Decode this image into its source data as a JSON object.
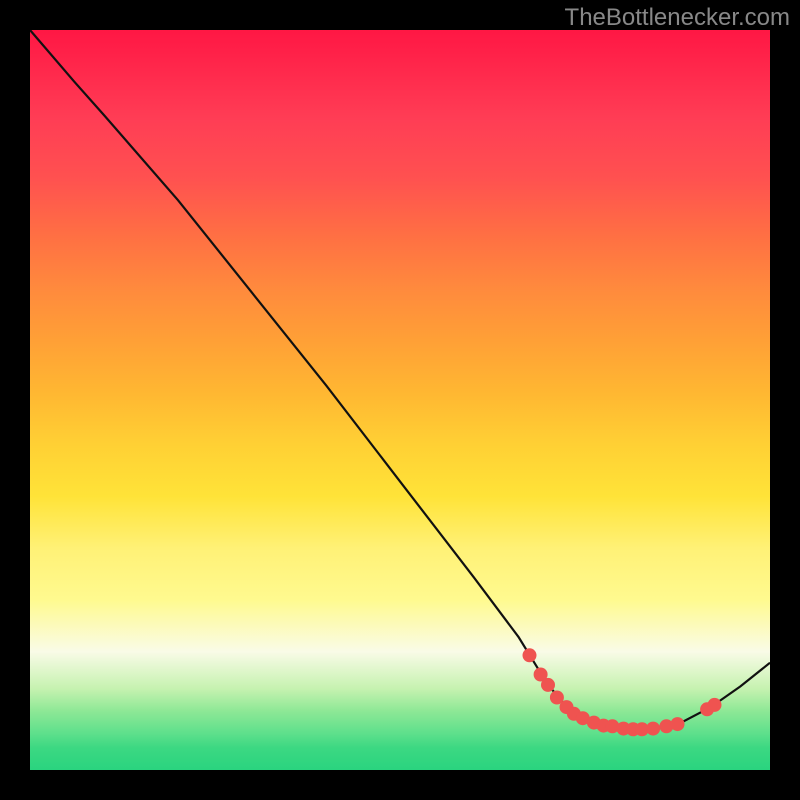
{
  "attribution": "TheBottlenecker.com",
  "chart_data": {
    "type": "line",
    "title": "",
    "xlabel": "",
    "ylabel": "",
    "xlim": [
      0,
      100
    ],
    "ylim": [
      0,
      100
    ],
    "curve_points_pct": [
      {
        "x": 0.0,
        "y": 0.0
      },
      {
        "x": 6.0,
        "y": 7.0
      },
      {
        "x": 10.0,
        "y": 11.5
      },
      {
        "x": 20.0,
        "y": 23.0
      },
      {
        "x": 30.0,
        "y": 35.5
      },
      {
        "x": 40.0,
        "y": 48.0
      },
      {
        "x": 50.0,
        "y": 61.0
      },
      {
        "x": 60.0,
        "y": 74.0
      },
      {
        "x": 66.0,
        "y": 82.0
      },
      {
        "x": 70.0,
        "y": 88.5
      },
      {
        "x": 73.0,
        "y": 92.0
      },
      {
        "x": 76.0,
        "y": 93.6
      },
      {
        "x": 80.0,
        "y": 94.4
      },
      {
        "x": 84.0,
        "y": 94.5
      },
      {
        "x": 88.0,
        "y": 93.6
      },
      {
        "x": 92.0,
        "y": 91.5
      },
      {
        "x": 96.0,
        "y": 88.7
      },
      {
        "x": 100.0,
        "y": 85.5
      }
    ],
    "dots_pct": [
      {
        "x": 67.5,
        "y": 84.5
      },
      {
        "x": 69.0,
        "y": 87.1
      },
      {
        "x": 70.0,
        "y": 88.5
      },
      {
        "x": 71.2,
        "y": 90.2
      },
      {
        "x": 72.5,
        "y": 91.5
      },
      {
        "x": 73.5,
        "y": 92.4
      },
      {
        "x": 74.7,
        "y": 93.0
      },
      {
        "x": 76.2,
        "y": 93.6
      },
      {
        "x": 77.5,
        "y": 94.0
      },
      {
        "x": 78.7,
        "y": 94.1
      },
      {
        "x": 80.2,
        "y": 94.4
      },
      {
        "x": 81.5,
        "y": 94.5
      },
      {
        "x": 82.7,
        "y": 94.5
      },
      {
        "x": 84.2,
        "y": 94.4
      },
      {
        "x": 86.0,
        "y": 94.1
      },
      {
        "x": 87.5,
        "y": 93.8
      },
      {
        "x": 91.5,
        "y": 91.8
      },
      {
        "x": 92.5,
        "y": 91.2
      }
    ],
    "dot_color": "#ef5350",
    "curve_color": "#111111"
  }
}
